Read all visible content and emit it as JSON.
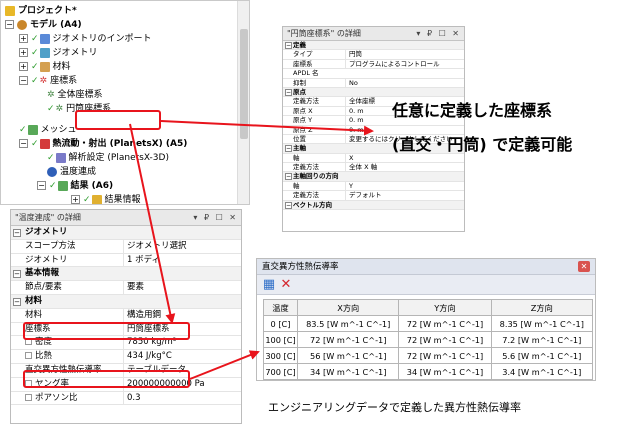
{
  "tree": {
    "project": "プロジェクト*",
    "model": "モデル (A4)",
    "geometry_import": "ジオメトリのインポート",
    "geometry": "ジオメトリ",
    "materials": "材料",
    "coord_systems": "座標系",
    "global_cs": "全体座標系",
    "cylindrical_cs": "円筒座標系",
    "mesh": "メッシュ",
    "analysis": "熱流動・射出 (PlanetsX) (A5)",
    "analysis_settings": "解析設定 (PlanetsX-3D)",
    "temp_coupling": "温度連成",
    "results": "結果 (A6)",
    "result_info": "結果情報"
  },
  "cyl_panel": {
    "title": "\"円筒座標系\" の詳細",
    "controls": "▾ ₽ ☐ ✕",
    "rows": [
      {
        "sec": true,
        "k": "定義",
        "v": ""
      },
      {
        "k": "タイプ",
        "v": "円筒"
      },
      {
        "k": "座標系",
        "v": "プログラムによるコントロール"
      },
      {
        "k": "APDL 名",
        "v": ""
      },
      {
        "k": "抑制",
        "v": "No"
      },
      {
        "sec": true,
        "k": "原点",
        "v": ""
      },
      {
        "k": "定義方法",
        "v": "全体座標"
      },
      {
        "k": "原点 X",
        "v": "0. m"
      },
      {
        "k": "原点 Y",
        "v": "0. m"
      },
      {
        "k": "原点 Z",
        "v": "0. m"
      },
      {
        "k": "位置",
        "v": "変更するにはクリックしてください"
      },
      {
        "sec": true,
        "k": "主軸",
        "v": ""
      },
      {
        "k": "軸",
        "v": "X"
      },
      {
        "k": "定義方法",
        "v": "全体 X 軸"
      },
      {
        "sec": true,
        "k": "主軸回りの方向",
        "v": ""
      },
      {
        "k": "軸",
        "v": "Y"
      },
      {
        "k": "定義方法",
        "v": "デフォルト"
      },
      {
        "sec": true,
        "k": "ベクトル方向",
        "v": ""
      }
    ]
  },
  "temp_panel": {
    "title": "\"温度連成\" の詳細",
    "controls": "▾ ₽ ☐ ✕",
    "rows": [
      {
        "sec": true,
        "k": "ジオメトリ",
        "v": ""
      },
      {
        "k": "スコープ方法",
        "v": "ジオメトリ選択"
      },
      {
        "k": "ジオメトリ",
        "v": "1 ボディ"
      },
      {
        "sec": true,
        "k": "基本情報",
        "v": ""
      },
      {
        "k": "節点/要素",
        "v": "要素"
      },
      {
        "sec": true,
        "k": "材料",
        "v": ""
      },
      {
        "k": "材料",
        "v": "構造用鋼"
      },
      {
        "k": "座標系",
        "v": "円筒座標系"
      },
      {
        "k": "密度",
        "v": "7850 kg/m³",
        "chk": true
      },
      {
        "k": "比熱",
        "v": "434 J/kg°C",
        "chk": true
      },
      {
        "k": "直交異方性熱伝導率",
        "v": "テーブルデータ"
      },
      {
        "k": "ヤング率",
        "v": "200000000000 Pa",
        "chk": true
      },
      {
        "k": "ポアソン比",
        "v": "0.3",
        "chk": true
      }
    ]
  },
  "ortho_table": {
    "title": "直交異方性熱伝導率",
    "headers": [
      "温度",
      "X方向",
      "Y方向",
      "Z方向"
    ],
    "rows": [
      [
        "0 [C]",
        "83.5 [W m^-1 C^-1]",
        "72 [W m^-1 C^-1]",
        "8.35 [W m^-1 C^-1]"
      ],
      [
        "100 [C]",
        "72 [W m^-1 C^-1]",
        "72 [W m^-1 C^-1]",
        "7.2 [W m^-1 C^-1]"
      ],
      [
        "300 [C]",
        "56 [W m^-1 C^-1]",
        "72 [W m^-1 C^-1]",
        "5.6 [W m^-1 C^-1]"
      ],
      [
        "700 [C]",
        "34 [W m^-1 C^-1]",
        "34 [W m^-1 C^-1]",
        "3.4 [W m^-1 C^-1]"
      ]
    ]
  },
  "annotations": {
    "headline1": "任意に定義した座標系",
    "headline2": "(直交・円筒) で定義可能",
    "caption": "エンジニアリングデータで定義した異方性熱伝導率"
  },
  "colors": {
    "accent_red": "#e8141c",
    "check_green": "#2d9b2d",
    "table_toolbar": "#e9ecf3"
  }
}
